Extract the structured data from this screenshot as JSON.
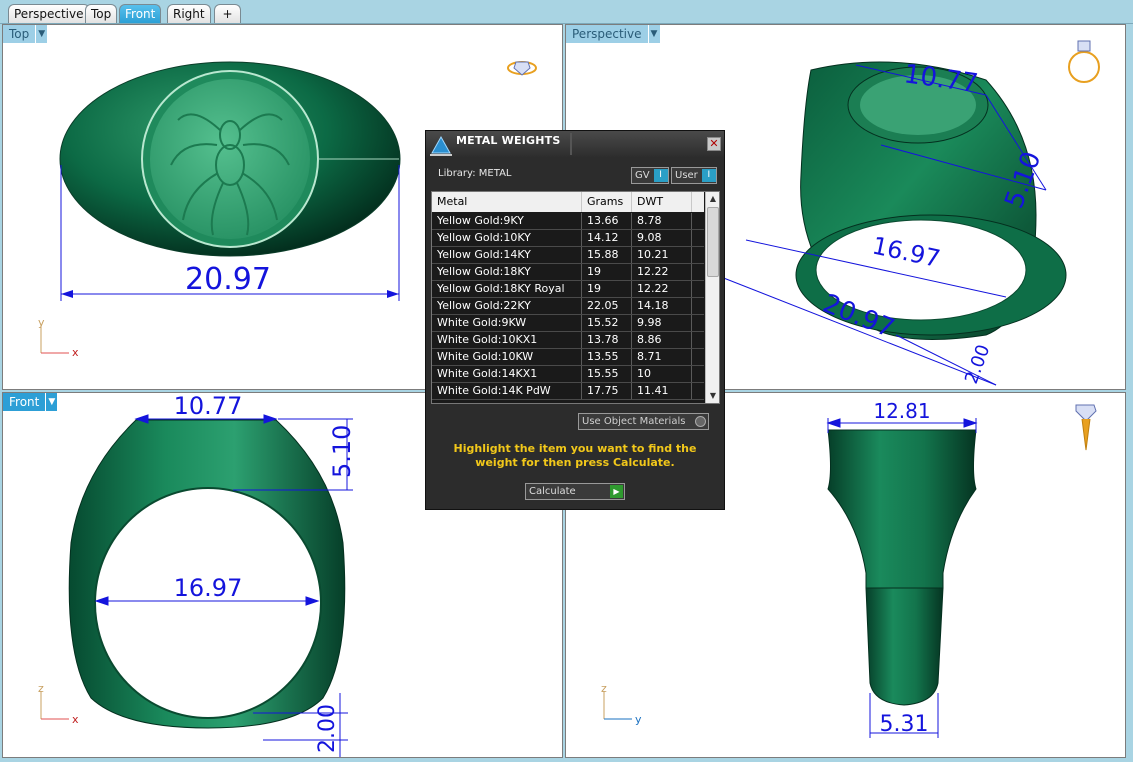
{
  "tabs": [
    {
      "label": "Perspective",
      "active": false
    },
    {
      "label": "Top",
      "active": false
    },
    {
      "label": "Front",
      "active": true
    },
    {
      "label": "Right",
      "active": false
    }
  ],
  "add_tab_glyph": "+",
  "viewports": {
    "top": {
      "label": "Top",
      "dim": "20.97",
      "axis_v": "y",
      "axis_h": "x"
    },
    "persp": {
      "label": "Perspective",
      "dims": [
        "10.77",
        "5.10",
        "16.97",
        "20.97",
        "2.00"
      ]
    },
    "front": {
      "label": "Front",
      "dims": [
        "10.77",
        "5.10",
        "16.97",
        "2.00"
      ],
      "axis_v": "z",
      "axis_h": "x"
    },
    "right": {
      "dims": [
        "12.81",
        "5.31"
      ],
      "axis_v": "z",
      "axis_h": "y"
    }
  },
  "dialog": {
    "title": "METAL WEIGHTS",
    "close_glyph": "✕",
    "library": "Library: METAL",
    "toggle_gv": "GV",
    "toggle_user": "User",
    "columns": [
      "Metal",
      "Grams",
      "DWT"
    ],
    "rows": [
      [
        "Yellow Gold:9KY",
        "13.66",
        "8.78"
      ],
      [
        "Yellow Gold:10KY",
        "14.12",
        "9.08"
      ],
      [
        "Yellow Gold:14KY",
        "15.88",
        "10.21"
      ],
      [
        "Yellow Gold:18KY",
        "19",
        "12.22"
      ],
      [
        "Yellow Gold:18KY Royal",
        "19",
        "12.22"
      ],
      [
        "Yellow Gold:22KY",
        "22.05",
        "14.18"
      ],
      [
        "White Gold:9KW",
        "15.52",
        "9.98"
      ],
      [
        "White Gold:10KX1",
        "13.78",
        "8.86"
      ],
      [
        "White Gold:10KW",
        "13.55",
        "8.71"
      ],
      [
        "White Gold:14KX1",
        "15.55",
        "10"
      ],
      [
        "White Gold:14K PdW",
        "17.75",
        "11.41"
      ]
    ],
    "use_object_materials": "Use Object Materials",
    "hint": "Highlight the item you want to find the weight for then press Calculate.",
    "calculate": "Calculate"
  },
  "icons": {
    "dropdown": "chevron-down-icon",
    "scroll_up": "arrow-up-icon",
    "scroll_down": "arrow-down-icon",
    "go": "play-icon",
    "ring_preview": "ring-icon"
  },
  "colors": {
    "ring_green": "#0f6e4a",
    "dimension_blue": "#1414dc",
    "tab_active": "#2d9fd6",
    "hint_yellow": "#f2c81a"
  }
}
